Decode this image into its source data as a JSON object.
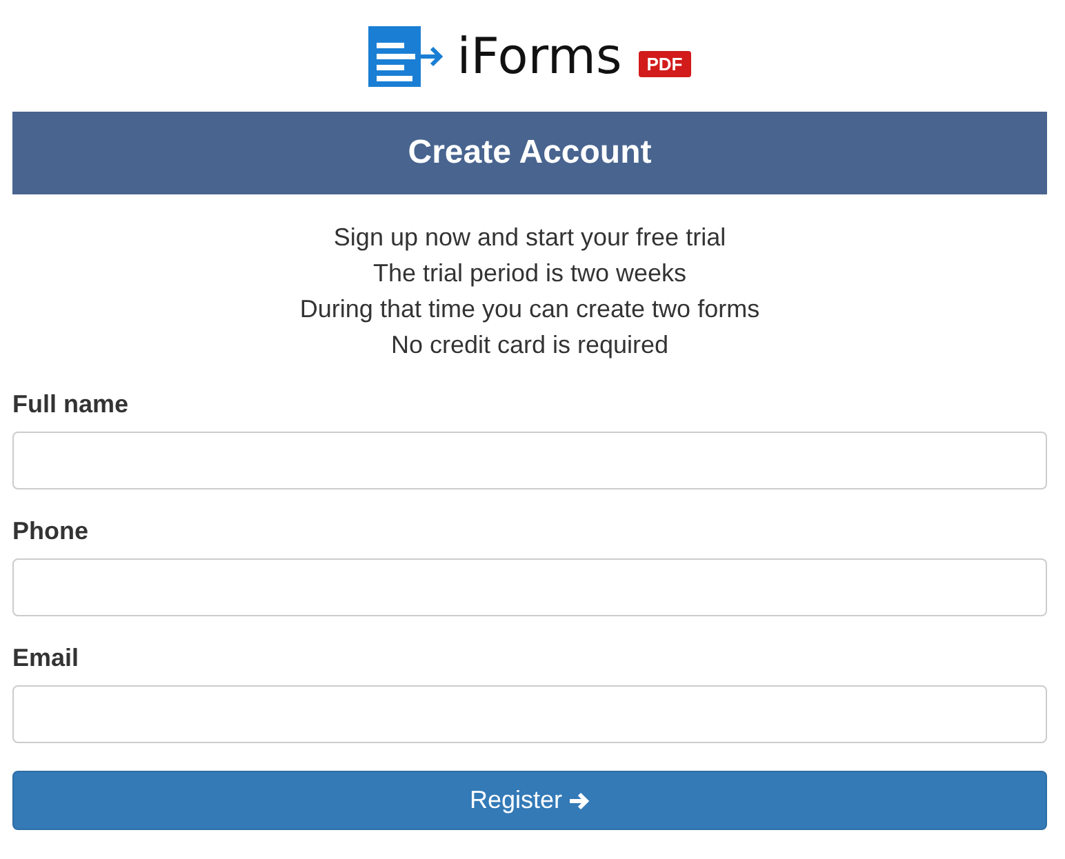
{
  "logo": {
    "name": "iForms",
    "badge": "PDF"
  },
  "header": {
    "title": "Create Account"
  },
  "intro": [
    "Sign up now and start your free trial",
    "The trial period is two weeks",
    "During that time you can create two forms",
    "No credit card is required"
  ],
  "fields": [
    {
      "label": "Full name"
    },
    {
      "label": "Phone"
    },
    {
      "label": "Email"
    }
  ],
  "submit": {
    "label": "Register"
  }
}
